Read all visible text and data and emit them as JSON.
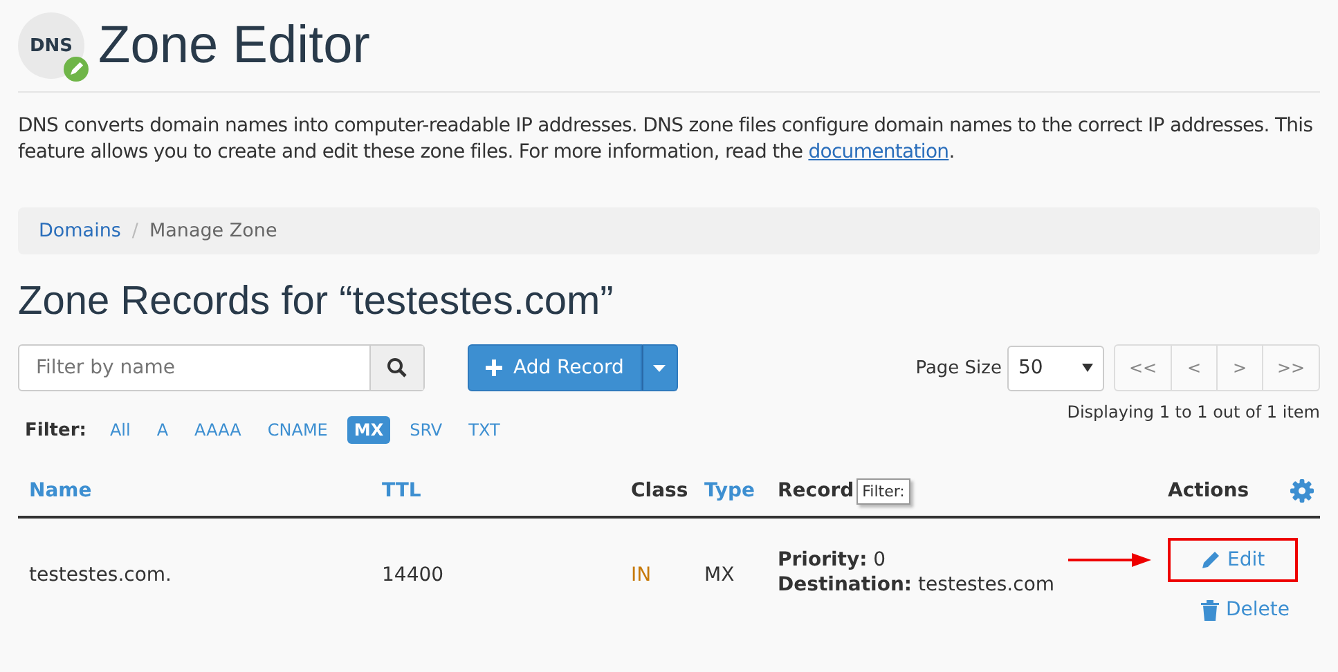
{
  "page": {
    "title": "Zone Editor",
    "icon_label": "DNS",
    "description": "DNS converts domain names into computer-readable IP addresses. DNS zone files configure domain names to the correct IP addresses. This feature allows you to create and edit these zone files. For more information, read the ",
    "description_link": "documentation",
    "description_end": "."
  },
  "breadcrumb_separator": "/",
  "breadcrumb": [
    {
      "label": "Domains",
      "link": true
    },
    {
      "label": "Manage Zone",
      "link": false
    }
  ],
  "section_title": "Zone Records for “testestes.com”",
  "search": {
    "placeholder": "Filter by name"
  },
  "add_button": "Add Record",
  "page_size": {
    "label": "Page Size",
    "value": "50"
  },
  "pager": [
    "<<",
    "<",
    ">",
    ">>"
  ],
  "displaying": "Displaying 1 to 1 out of 1 item",
  "filter": {
    "label": "Filter:",
    "options": [
      {
        "label": "All",
        "selected": false
      },
      {
        "label": "A",
        "selected": false
      },
      {
        "label": "AAAA",
        "selected": false
      },
      {
        "label": "CNAME",
        "selected": false
      },
      {
        "label": "MX",
        "selected": true
      },
      {
        "label": "SRV",
        "selected": false
      },
      {
        "label": "TXT",
        "selected": false
      }
    ]
  },
  "table": {
    "columns": [
      {
        "label": "Name",
        "sortable": true
      },
      {
        "label": "TTL",
        "sortable": true
      },
      {
        "label": "Class",
        "sortable": false
      },
      {
        "label": "Type",
        "sortable": true
      },
      {
        "label": "Record",
        "sortable": false
      },
      {
        "label": "Actions",
        "sortable": false
      }
    ],
    "tooltip": "Filter:",
    "rows": [
      {
        "name": "testestes.com.",
        "ttl": "14400",
        "class": "IN",
        "type": "MX",
        "record": [
          {
            "key": "Priority:",
            "value": "0"
          },
          {
            "key": "Destination:",
            "value": "testestes.com"
          }
        ],
        "actions": [
          {
            "kind": "edit",
            "label": "Edit",
            "highlighted": true
          },
          {
            "kind": "delete",
            "label": "Delete",
            "highlighted": false
          }
        ]
      }
    ]
  }
}
